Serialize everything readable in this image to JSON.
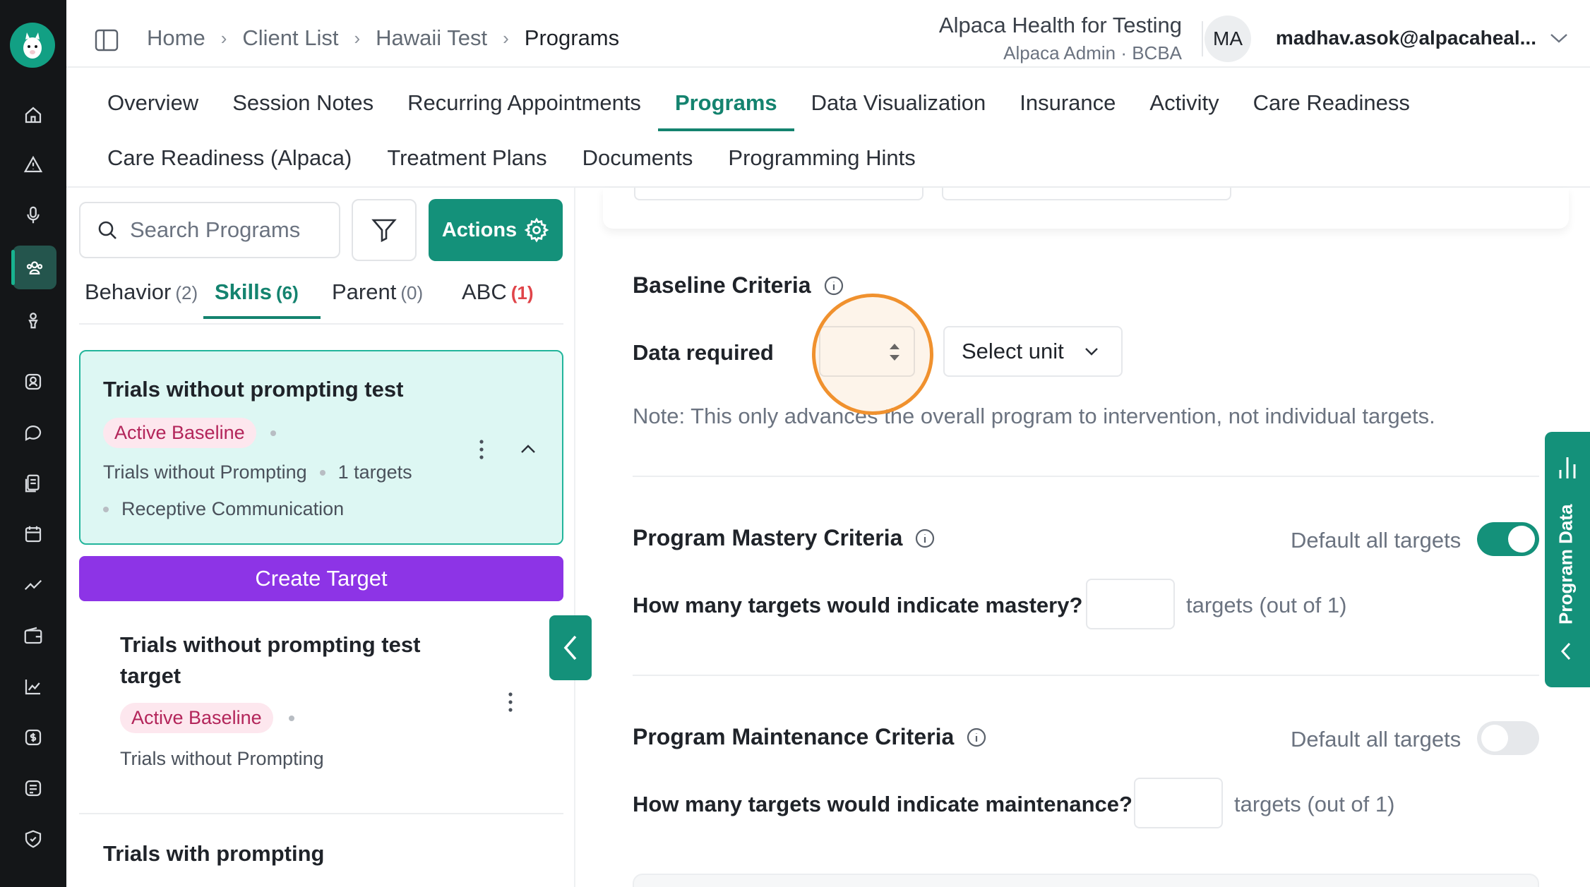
{
  "header": {
    "breadcrumbs": [
      "Home",
      "Client List",
      "Hawaii Test",
      "Programs"
    ],
    "org_name": "Alpaca Health for Testing",
    "org_role": "Alpaca Admin · BCBA",
    "avatar_initials": "MA",
    "user_email": "madhav.asok@alpacaheal..."
  },
  "tabs_row1": [
    "Overview",
    "Session Notes",
    "Recurring Appointments",
    "Programs",
    "Data Visualization",
    "Insurance",
    "Activity",
    "Care Readiness"
  ],
  "tabs_row2": [
    "Care Readiness (Alpaca)",
    "Treatment Plans",
    "Documents",
    "Programming Hints"
  ],
  "left_panel": {
    "search_placeholder": "Search Programs",
    "actions_label": "Actions",
    "program_tabs": [
      {
        "label": "Behavior",
        "count": "(2)"
      },
      {
        "label": "Skills",
        "count": "(6)"
      },
      {
        "label": "Parent",
        "count": "(0)"
      },
      {
        "label": "ABC",
        "count": "(1)"
      }
    ],
    "selected_program": {
      "title": "Trials without prompting test",
      "status": "Active Baseline",
      "method": "Trials without Prompting",
      "targets": "1 targets",
      "domain": "Receptive Communication"
    },
    "create_target_label": "Create Target",
    "target": {
      "title_line1": "Trials without prompting test",
      "title_line2": "target",
      "status": "Active Baseline",
      "method": "Trials without Prompting"
    },
    "next_program_title": "Trials with prompting"
  },
  "baseline": {
    "title": "Baseline Criteria",
    "data_required_label": "Data required",
    "data_required_value": "",
    "unit_placeholder": "Select unit",
    "note": "Note: This only advances the overall program to intervention, not individual targets."
  },
  "mastery": {
    "title": "Program Mastery Criteria",
    "default_label": "Default all targets",
    "default_on": true,
    "question": "How many targets would indicate mastery?",
    "value": "",
    "suffix": "targets (out of 1)"
  },
  "maintenance": {
    "title": "Program Maintenance Criteria",
    "default_label": "Default all targets",
    "default_on": false,
    "question": "How many targets would indicate maintenance?",
    "value": "",
    "suffix": "targets (out of 1)"
  },
  "program_data_tab": "Program Data",
  "colors": {
    "brand": "#14917a",
    "purple": "#8d34e6",
    "badge_text": "#b3255a",
    "highlight": "#f0912e"
  }
}
